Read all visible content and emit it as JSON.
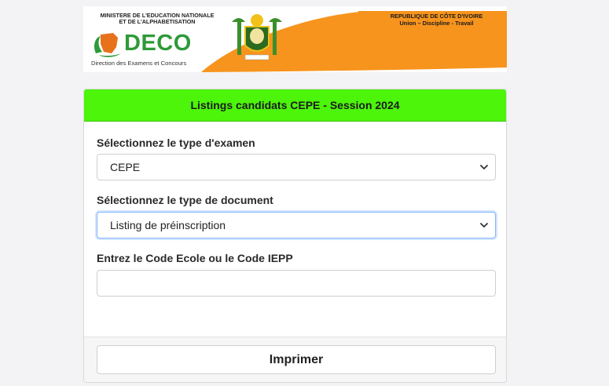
{
  "banner": {
    "ministry_line1": "MINISTERE DE L'EDUCATION NATIONALE",
    "ministry_line2": "ET DE L'ALPHABETISATION",
    "logo_text": "DECO",
    "logo_subtitle": "Direction des Examens et Concours",
    "republic_line1": "REPUBLIQUE DE CÔTE D'IVOIRE",
    "republic_line2": "Union – Discipline - Travail",
    "accent_color": "#f7941d"
  },
  "form": {
    "title": "Listings candidats CEPE - Session 2024",
    "exam_type_label": "Sélectionnez le type d'examen",
    "exam_type_value": "CEPE",
    "doc_type_label": "Sélectionnez le type de document",
    "doc_type_value": "Listing de préinscription",
    "code_label": "Entrez le Code Ecole ou le Code IEPP",
    "code_value": "",
    "print_button": "Imprimer",
    "header_color": "#4cf50a"
  }
}
